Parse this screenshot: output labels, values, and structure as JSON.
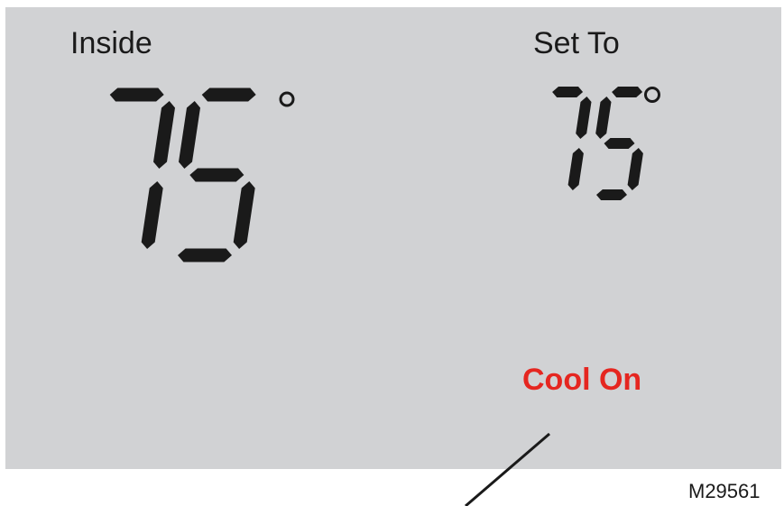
{
  "display": {
    "inside_label": "Inside",
    "inside_temperature": "75",
    "setto_label": "Set To",
    "setpoint_temperature": "75",
    "status_text": "Cool On",
    "figure_id": "M29561"
  },
  "colors": {
    "screen": "#d1d2d4",
    "segment": "#1a1a1a",
    "status": "#e52620"
  },
  "icons": {
    "degree_symbol": "degree-symbol-icon",
    "callout": "callout-leader-line"
  }
}
